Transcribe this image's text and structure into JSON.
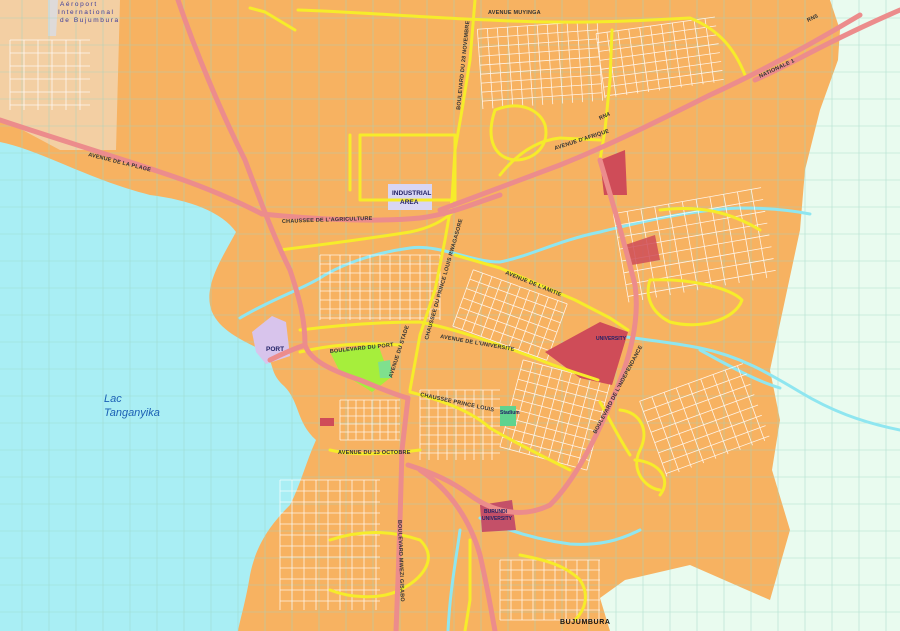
{
  "map": {
    "airport": {
      "line1": "Aéroport",
      "line2": "International",
      "line3": "de Bujumbura"
    },
    "lake": {
      "line1": "Lac",
      "line2": "Tanganyika"
    },
    "city": "BUJUMBURA",
    "areas": {
      "industrial_line1": "INDUSTRIAL",
      "industrial_line2": "AREA",
      "port": "PORT",
      "university": "UNIVERSITY",
      "burundi_university_line1": "BURUNDI",
      "burundi_university_line2": "UNIVERSITY",
      "stadium": "Stadium"
    },
    "roads": {
      "ave_muyinga": "AVENUE MUYINGA",
      "rn1": "NATIONALE 1",
      "rn5": "RN5",
      "chaussee_agriculture": "CHAUSSEE DE L'AGRICULTURE",
      "ave_de_la_plage": "AVENUE DE LA PLAGE",
      "chaussee_rwagasore": "CHAUSSEE DU PRINCE LOUIS RWAGASORE",
      "boulevard_du_28_novembre": "BOULEVARD DU 28 NOVEMBRE",
      "ave_univ": "AVENUE DE L'UNIVERSITE",
      "ave_de_lamitie": "AVENUE DE L'AMITIE",
      "boulevard_du_port": "BOULEVARD DU PORT",
      "ave_13_octobre": "AVENUE DU 13 OCTOBRE",
      "chaussee_prince_louis": "CHAUSSEE PRINCE LOUIS",
      "boulevard_independance": "BOULEVARD DE L'INDEPENDANCE",
      "ave_dafrique": "AVENUE D'AFRIQUE",
      "ave_du_stade": "AVENUE DU STADE",
      "blvd_mwezi": "BOULEVARD MWEZI GISABO",
      "rn4": "RN4"
    }
  },
  "colors": {
    "land": "#f7b261",
    "lake": "#a9eef4",
    "countryside": "#e9fbef",
    "airport_ground": "#f3cfa3",
    "grid": "#9dd6c4",
    "major_road": "#ec8c8c",
    "yellow_road": "#f6ec2a",
    "street": "#ffffff",
    "river": "#8fe6f0",
    "university": "#cf4c58",
    "park": "#a6ee3c",
    "industrial": "#d8d6f4",
    "port": "#d8c4ec",
    "stadium": "#5fd38f"
  }
}
